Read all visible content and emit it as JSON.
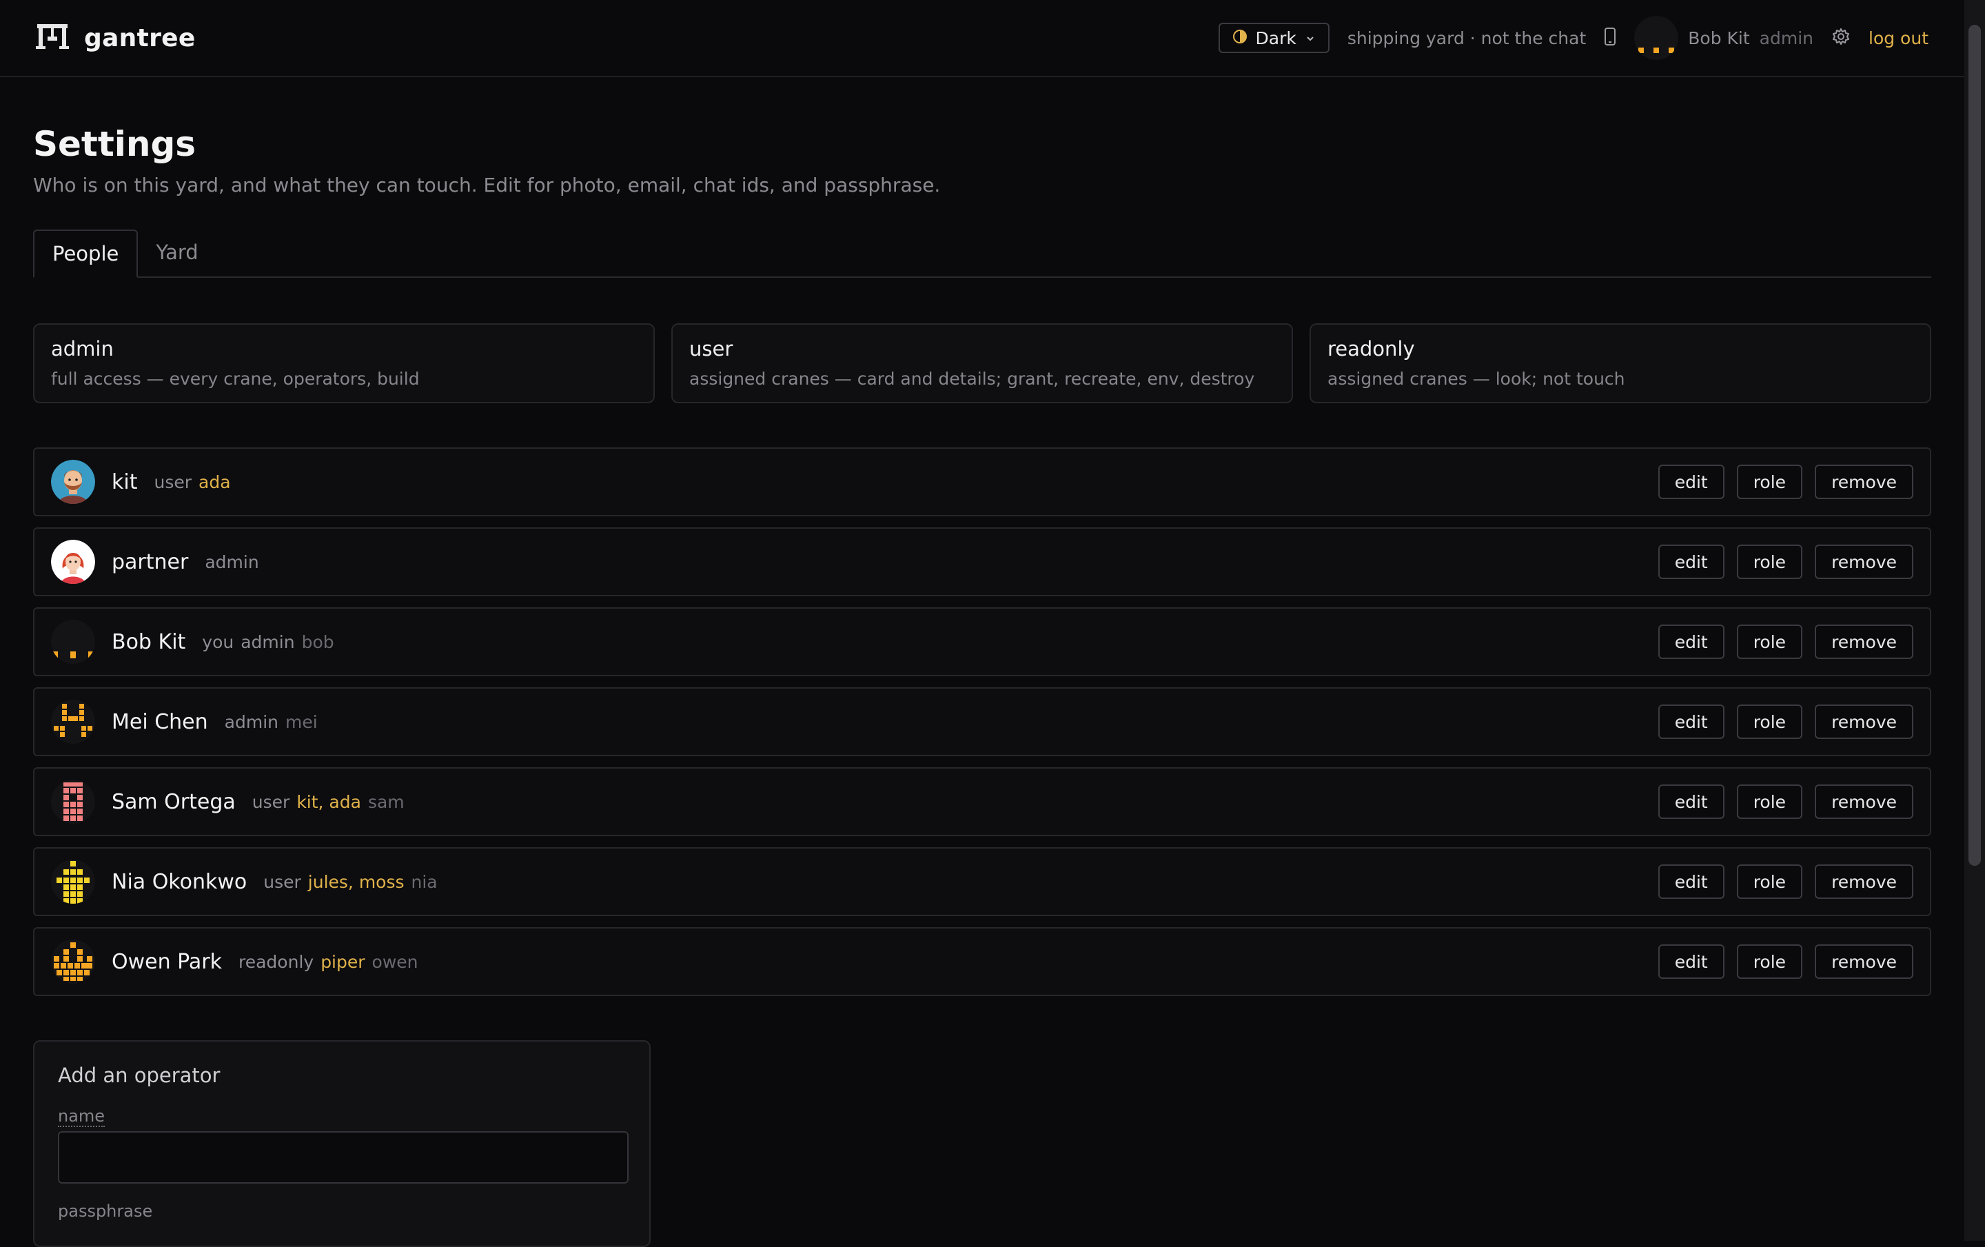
{
  "app": {
    "name": "gantree"
  },
  "header": {
    "theme_label": "Dark",
    "yard_label": "shipping yard · not the chat",
    "user_name": "Bob Kit",
    "user_role": "admin",
    "logout_label": "log out",
    "accent": "#e0b24a"
  },
  "page": {
    "title": "Settings",
    "subtitle": "Who is on this yard, and what they can touch. Edit for photo, email, chat ids, and passphrase."
  },
  "tabs": [
    {
      "label": "People",
      "active": true
    },
    {
      "label": "Yard",
      "active": false
    }
  ],
  "roles": [
    {
      "name": "admin",
      "desc": "full access — every crane, operators, build"
    },
    {
      "name": "user",
      "desc": "assigned cranes — card and details; grant, recreate, env, destroy"
    },
    {
      "name": "readonly",
      "desc": "assigned cranes — look; not touch"
    }
  ],
  "actions": {
    "edit": "edit",
    "role": "role",
    "remove": "remove"
  },
  "people": [
    {
      "name": "kit",
      "you": "",
      "role": "user",
      "cranes": "ada",
      "handle": ""
    },
    {
      "name": "partner",
      "you": "",
      "role": "admin",
      "cranes": "",
      "handle": ""
    },
    {
      "name": "Bob Kit",
      "you": "you",
      "role": "admin",
      "cranes": "",
      "handle": "bob"
    },
    {
      "name": "Mei Chen",
      "you": "",
      "role": "admin",
      "cranes": "",
      "handle": "mei"
    },
    {
      "name": "Sam Ortega",
      "you": "",
      "role": "user",
      "cranes": "kit, ada",
      "handle": "sam"
    },
    {
      "name": "Nia Okonkwo",
      "you": "",
      "role": "user",
      "cranes": "jules, moss",
      "handle": "nia"
    },
    {
      "name": "Owen Park",
      "you": "",
      "role": "readonly",
      "cranes": "piper",
      "handle": "owen"
    }
  ],
  "add_operator": {
    "title": "Add an operator",
    "name_label": "name",
    "passphrase_label": "passphrase"
  }
}
